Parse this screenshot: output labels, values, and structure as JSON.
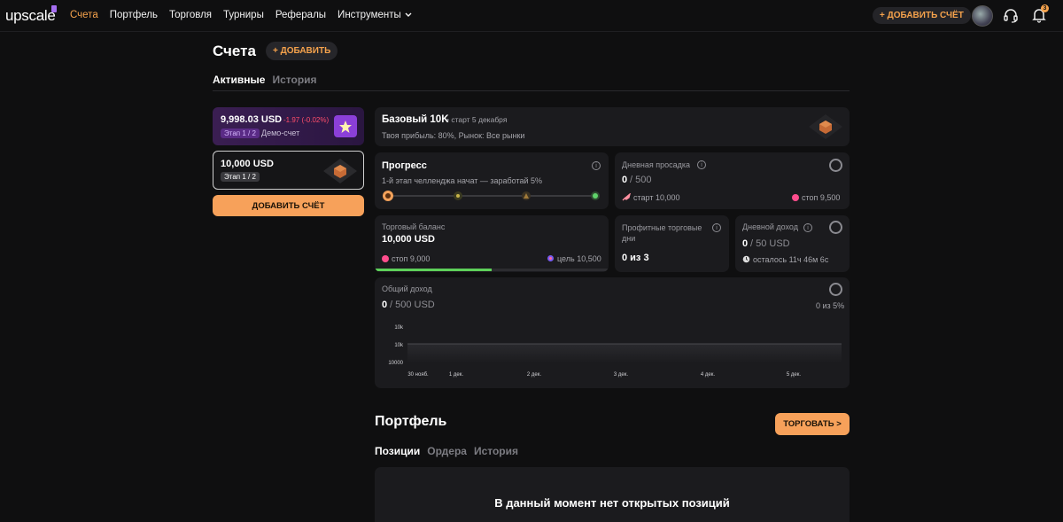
{
  "nav": {
    "logo": "upscale",
    "items": [
      "Счета",
      "Портфель",
      "Торговля",
      "Турниры",
      "Рефералы",
      "Инструменты"
    ],
    "add_account": "+ ДОБАВИТЬ СЧЁТ",
    "notif_count": "3"
  },
  "page": {
    "title": "Счета",
    "add_label": "+ ДОБАВИТЬ",
    "tabs": [
      "Активные",
      "История"
    ]
  },
  "accounts": [
    {
      "balance": "9,998.03 USD",
      "change": "-1.97 (-0.02%)",
      "stage": "Этап 1 / 2",
      "type": "Демо-счет"
    },
    {
      "balance": "10,000 USD",
      "stage": "Этап 1 / 2"
    }
  ],
  "create_button": "ДОБАВИТЬ СЧЁТ",
  "plan": {
    "name": "Базовый 10K",
    "start": "• старт 5 декабря",
    "details": "Твоя прибыль: 80%, Рынок: Все рынки"
  },
  "progress": {
    "title": "Прогресс",
    "subtitle": "1-й этап челленджа начат — заработай 5%"
  },
  "drawdown": {
    "title": "Дневная просадка",
    "current": "0",
    "max": "/ 500",
    "start": "старт 10,000",
    "stop": "стоп 9,500"
  },
  "balance": {
    "title": "Торговый баланс",
    "value": "10,000 USD",
    "stop": "стоп 9,000",
    "target": "цель 10,500",
    "progress": 0.5
  },
  "profit_days": {
    "title": "Профитные торговые дни",
    "value": "0 из 3"
  },
  "daily_income": {
    "title": "Дневной доход",
    "current": "0",
    "max": "/ 50 USD",
    "remaining": "осталось 11ч 46м 6с"
  },
  "total_income": {
    "title": "Общий доход",
    "current": "0",
    "max": "/ 500 USD",
    "percent": "0 из 5%"
  },
  "chart_data": {
    "type": "area",
    "y_ticks": [
      "10k",
      "10k",
      "10000"
    ],
    "x_ticks": [
      "30 нояб.",
      "1 дек.",
      "2 дек.",
      "3 дек.",
      "4 дек.",
      "5 дек."
    ],
    "values": [
      10000,
      10000,
      10000,
      10000,
      10000,
      10000
    ]
  },
  "portfolio": {
    "title": "Портфель",
    "trade_button": "ТОРГОВАТЬ >",
    "tabs": [
      "Позиции",
      "Ордера",
      "История"
    ],
    "empty": "В данный момент нет открытых позиций"
  }
}
